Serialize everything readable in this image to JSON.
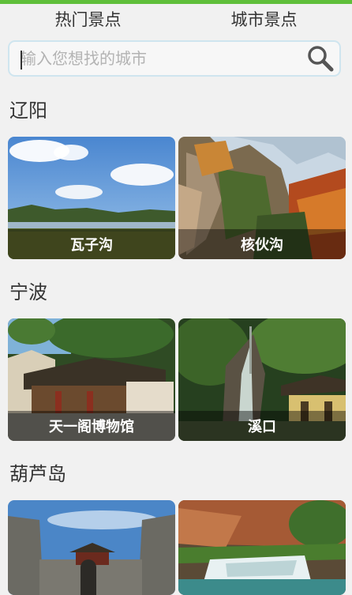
{
  "tabs": [
    {
      "label": "热门景点"
    },
    {
      "label": "城市景点"
    }
  ],
  "search": {
    "placeholder": "输入您想找的城市",
    "value": ""
  },
  "sections": [
    {
      "city": "辽阳",
      "spots": [
        {
          "name": "瓦子沟"
        },
        {
          "name": "核伙沟"
        }
      ]
    },
    {
      "city": "宁波",
      "spots": [
        {
          "name": "天一阁博物馆"
        },
        {
          "name": "溪口"
        }
      ]
    },
    {
      "city": "葫芦岛",
      "spots": [
        {
          "name": ""
        },
        {
          "name": ""
        }
      ]
    }
  ],
  "colors": {
    "accent": "#5fbf3a",
    "search_border": "#cfe5ef"
  }
}
